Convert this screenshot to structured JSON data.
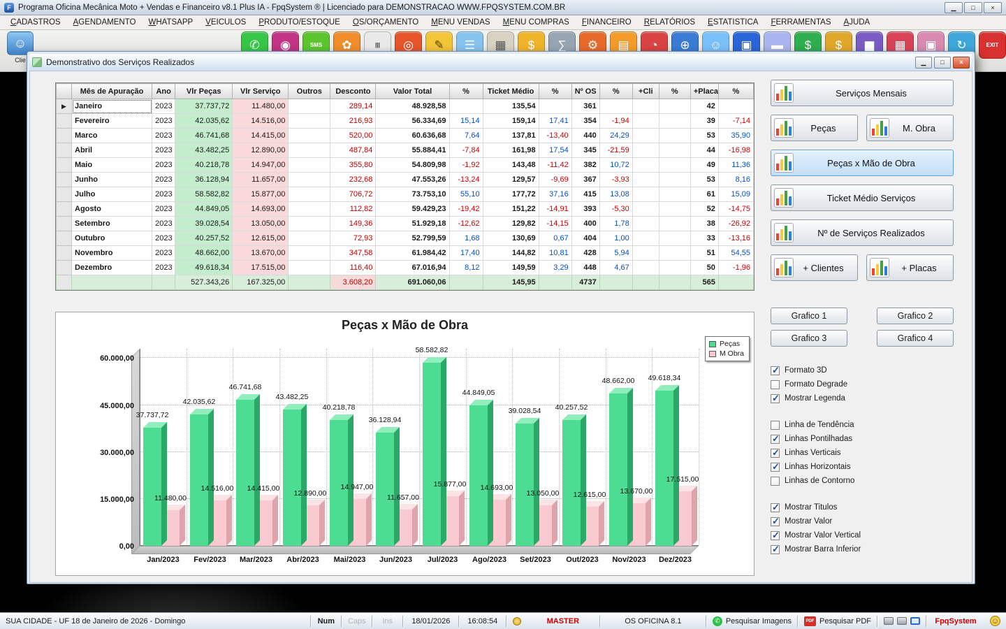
{
  "app": {
    "title": "Programa Oficina Mecânica Moto + Vendas e Financeiro v8.1 Plus IA - FpqSystem ® | Licenciado para  DEMONSTRACAO WWW.FPQSYSTEM.COM.BR",
    "buttons": {
      "minimize": "▁",
      "maximize": "□",
      "close": "×"
    }
  },
  "menubar": {
    "items": [
      "CADASTROS",
      "AGENDAMENTO",
      "WHATSAPP",
      "VEICULOS",
      "PRODUTO/ESTOQUE",
      "OS/ORÇAMENTO",
      "MENU VENDAS",
      "MENU COMPRAS",
      "FINANCEIRO",
      "RELATÓRIOS",
      "ESTATISTICA",
      "FERRAMENTAS",
      "AJUDA"
    ]
  },
  "toolbar": {
    "left_button": {
      "label": "Clie",
      "glyph": "☺"
    },
    "icons": [
      {
        "name": "whatsapp-icon",
        "glyph": "✆",
        "bg": "#36c746"
      },
      {
        "name": "instagram-icon",
        "glyph": "◉",
        "bg": "#c13584"
      },
      {
        "name": "sms-icon",
        "glyph": "SMS",
        "bg": "#5cc52e"
      },
      {
        "name": "produtos-icon",
        "glyph": "✿",
        "bg": "#f08c2a"
      },
      {
        "name": "barcode-icon",
        "glyph": "|||",
        "bg": "#e9e9e9",
        "fg": "#222222"
      },
      {
        "name": "ordem-servico-icon",
        "glyph": "◎",
        "bg": "#e8542a"
      },
      {
        "name": "orcamento-icon",
        "glyph": "✎",
        "bg": "#f3c63a",
        "fg": "#554400"
      },
      {
        "name": "checklist-icon",
        "glyph": "☰",
        "bg": "#86c3ef"
      },
      {
        "name": "agenda-icon",
        "glyph": "▦",
        "bg": "#d8d2c2",
        "fg": "#555555"
      },
      {
        "name": "caixa-icon",
        "glyph": "$",
        "bg": "#f0b42a"
      },
      {
        "name": "calculadora-icon",
        "glyph": "∑",
        "bg": "#97a5b2"
      },
      {
        "name": "ferramentas-icon",
        "glyph": "⚙",
        "bg": "#e86a2a"
      },
      {
        "name": "pastas-icon",
        "glyph": "▤",
        "bg": "#f49b2a"
      },
      {
        "name": "horario-icon",
        "glyph": "◔",
        "bg": "#d94343"
      },
      {
        "name": "internet-icon",
        "glyph": "⊕",
        "bg": "#3a7bd5"
      },
      {
        "name": "clientes-icon",
        "glyph": "☺",
        "bg": "#79c0f8"
      },
      {
        "name": "computador-icon",
        "glyph": "▣",
        "bg": "#2a66d9"
      },
      {
        "name": "cartoes-icon",
        "glyph": "▬",
        "bg": "#aab4ee"
      },
      {
        "name": "financeiro-icon",
        "glyph": "$",
        "bg": "#2fae4f"
      },
      {
        "name": "lucro-icon",
        "glyph": "$",
        "bg": "#e0a82a"
      },
      {
        "name": "graficos-icon",
        "glyph": "▆",
        "bg": "#7a5cc4"
      },
      {
        "name": "calendario-icon",
        "glyph": "▦",
        "bg": "#d94358"
      },
      {
        "name": "impressora-icon",
        "glyph": "▣",
        "bg": "#d98ab0"
      },
      {
        "name": "atualizar-icon",
        "glyph": "↻",
        "bg": "#3fa7d9"
      },
      {
        "name": "sair-icon",
        "glyph": "EXIT",
        "bg": "#d93030"
      }
    ]
  },
  "dialog": {
    "title": "Demonstrativo dos Serviços Realizados",
    "buttons": {
      "minimize": "▁",
      "maximize": "□",
      "close": "×"
    },
    "table": {
      "headers": [
        "Mês de Apuração",
        "Ano",
        "Vlr Peças",
        "Vlr Serviço",
        "Outros",
        "Desconto",
        "Valor Total",
        "%",
        "Ticket Médio",
        "%",
        "Nº OS",
        "%",
        "+Cli",
        "%",
        "+Placa",
        "%"
      ],
      "rows": [
        {
          "mes": "Janeiro",
          "ano": "2023",
          "pecas": "37.737,72",
          "servico": "11.480,00",
          "desconto": "289,14",
          "total": "48.928,58",
          "pct_total": "",
          "ticket": "135,54",
          "pct_ticket": "",
          "os": "361",
          "pct_os": "",
          "placa": "42",
          "pct_placa": ""
        },
        {
          "mes": "Fevereiro",
          "ano": "2023",
          "pecas": "42.035,62",
          "servico": "14.516,00",
          "desconto": "216,93",
          "total": "56.334,69",
          "pct_total": "15,14",
          "ticket": "159,14",
          "pct_ticket": "17,41",
          "os": "354",
          "pct_os": "-1,94",
          "placa": "39",
          "pct_placa": "-7,14"
        },
        {
          "mes": "Marco",
          "ano": "2023",
          "pecas": "46.741,68",
          "servico": "14.415,00",
          "desconto": "520,00",
          "total": "60.636,68",
          "pct_total": "7,64",
          "ticket": "137,81",
          "pct_ticket": "-13,40",
          "os": "440",
          "pct_os": "24,29",
          "placa": "53",
          "pct_placa": "35,90"
        },
        {
          "mes": "Abril",
          "ano": "2023",
          "pecas": "43.482,25",
          "servico": "12.890,00",
          "desconto": "487,84",
          "total": "55.884,41",
          "pct_total": "-7,84",
          "ticket": "161,98",
          "pct_ticket": "17,54",
          "os": "345",
          "pct_os": "-21,59",
          "placa": "44",
          "pct_placa": "-16,98"
        },
        {
          "mes": "Maio",
          "ano": "2023",
          "pecas": "40.218,78",
          "servico": "14.947,00",
          "desconto": "355,80",
          "total": "54.809,98",
          "pct_total": "-1,92",
          "ticket": "143,48",
          "pct_ticket": "-11,42",
          "os": "382",
          "pct_os": "10,72",
          "placa": "49",
          "pct_placa": "11,36"
        },
        {
          "mes": "Junho",
          "ano": "2023",
          "pecas": "36.128,94",
          "servico": "11.657,00",
          "desconto": "232,68",
          "total": "47.553,26",
          "pct_total": "-13,24",
          "ticket": "129,57",
          "pct_ticket": "-9,69",
          "os": "367",
          "pct_os": "-3,93",
          "placa": "53",
          "pct_placa": "8,16"
        },
        {
          "mes": "Julho",
          "ano": "2023",
          "pecas": "58.582,82",
          "servico": "15.877,00",
          "desconto": "706,72",
          "total": "73.753,10",
          "pct_total": "55,10",
          "ticket": "177,72",
          "pct_ticket": "37,16",
          "os": "415",
          "pct_os": "13,08",
          "placa": "61",
          "pct_placa": "15,09"
        },
        {
          "mes": "Agosto",
          "ano": "2023",
          "pecas": "44.849,05",
          "servico": "14.693,00",
          "desconto": "112,82",
          "total": "59.429,23",
          "pct_total": "-19,42",
          "ticket": "151,22",
          "pct_ticket": "-14,91",
          "os": "393",
          "pct_os": "-5,30",
          "placa": "52",
          "pct_placa": "-14,75"
        },
        {
          "mes": "Setembro",
          "ano": "2023",
          "pecas": "39.028,54",
          "servico": "13.050,00",
          "desconto": "149,36",
          "total": "51.929,18",
          "pct_total": "-12,62",
          "ticket": "129,82",
          "pct_ticket": "-14,15",
          "os": "400",
          "pct_os": "1,78",
          "placa": "38",
          "pct_placa": "-26,92"
        },
        {
          "mes": "Outubro",
          "ano": "2023",
          "pecas": "40.257,52",
          "servico": "12.615,00",
          "desconto": "72,93",
          "total": "52.799,59",
          "pct_total": "1,68",
          "ticket": "130,69",
          "pct_ticket": "0,67",
          "os": "404",
          "pct_os": "1,00",
          "placa": "33",
          "pct_placa": "-13,16"
        },
        {
          "mes": "Novembro",
          "ano": "2023",
          "pecas": "48.662,00",
          "servico": "13.670,00",
          "desconto": "347,58",
          "total": "61.984,42",
          "pct_total": "17,40",
          "ticket": "144,82",
          "pct_ticket": "10,81",
          "os": "428",
          "pct_os": "5,94",
          "placa": "51",
          "pct_placa": "54,55"
        },
        {
          "mes": "Dezembro",
          "ano": "2023",
          "pecas": "49.618,34",
          "servico": "17.515,00",
          "desconto": "116,40",
          "total": "67.016,94",
          "pct_total": "8,12",
          "ticket": "149,59",
          "pct_ticket": "3,29",
          "os": "448",
          "pct_os": "4,67",
          "placa": "50",
          "pct_placa": "-1,96"
        }
      ],
      "totals": {
        "pecas": "527.343,26",
        "servico": "167.325,00",
        "desconto": "3.608,20",
        "total": "691.060,06",
        "ticket": "145,95",
        "os": "4737",
        "placa": "565"
      }
    },
    "side_panel": {
      "view_buttons": [
        {
          "label": "Serviços Mensais",
          "width": "full"
        },
        {
          "label": "Peças",
          "width": "half"
        },
        {
          "label": "M. Obra",
          "width": "half"
        },
        {
          "label": "Peças x Mão de Obra",
          "width": "full",
          "active": true
        },
        {
          "label": "Ticket Médio Serviços",
          "width": "full"
        },
        {
          "label": "Nº de Serviços Realizados",
          "width": "full"
        },
        {
          "label": "+ Clientes",
          "width": "half"
        },
        {
          "label": "+ Placas",
          "width": "half"
        }
      ],
      "graph_buttons": [
        "Grafico 1",
        "Grafico 2",
        "Grafico 3",
        "Grafico 4"
      ],
      "checkbox_groups": [
        [
          {
            "label": "Formato 3D",
            "checked": true
          },
          {
            "label": "Formato Degrade",
            "checked": false
          },
          {
            "label": "Mostrar Legenda",
            "checked": true
          }
        ],
        [
          {
            "label": "Linha de Tendência",
            "checked": false
          },
          {
            "label": "Linhas Pontilhadas",
            "checked": true
          },
          {
            "label": "Linhas Verticais",
            "checked": true
          },
          {
            "label": "Linhas Horizontais",
            "checked": true
          },
          {
            "label": "Linhas de Contorno",
            "checked": false
          }
        ],
        [
          {
            "label": "Mostrar Titulos",
            "checked": true
          },
          {
            "label": "Mostrar Valor",
            "checked": true
          },
          {
            "label": "Mostrar Valor Vertical",
            "checked": true
          },
          {
            "label": "Mostrar Barra Inferior",
            "checked": true
          }
        ]
      ]
    }
  },
  "chart_data": {
    "type": "bar",
    "style": "3d-bar",
    "title": "Peças x Mão de Obra",
    "categories": [
      "Jan/2023",
      "Fev/2023",
      "Mar/2023",
      "Abr/2023",
      "Mai/2023",
      "Jun/2023",
      "Jul/2023",
      "Ago/2023",
      "Set/2023",
      "Out/2023",
      "Nov/2023",
      "Dez/2023"
    ],
    "series": [
      {
        "name": "Peças",
        "color": "#4cdd92",
        "values": [
          37737.72,
          42035.62,
          46741.68,
          43482.25,
          40218.78,
          36128.94,
          58582.82,
          44849.05,
          39028.54,
          40257.52,
          48662.0,
          49618.34
        ],
        "labels": [
          "37.737,72",
          "42.035,62",
          "46.741,68",
          "43.482,25",
          "40.218,78",
          "36.128,94",
          "58.582,82",
          "44.849,05",
          "39.028,54",
          "40.257,52",
          "48.662,00",
          "49.618,34"
        ]
      },
      {
        "name": "M Obra",
        "color": "#f9cbd0",
        "values": [
          11480,
          14516,
          14415,
          12890,
          14947,
          11657,
          15877,
          14693,
          13050,
          12615,
          13670,
          17515
        ],
        "labels": [
          "11.480,00",
          "14.516,00",
          "14.415,00",
          "12.890,00",
          "14.947,00",
          "11.657,00",
          "15.877,00",
          "14.693,00",
          "13.050,00",
          "12.615,00",
          "13.670,00",
          "17.515,00"
        ]
      }
    ],
    "ylim": [
      0,
      60000
    ],
    "yticks": [
      "0,00",
      "15.000,00",
      "30.000,00",
      "45.000,00",
      "60.000,00"
    ],
    "ytick_values": [
      0,
      15000,
      30000,
      45000,
      60000
    ],
    "grid": true,
    "legend_position": "top-right"
  },
  "statusbar": {
    "location": "SUA CIDADE - UF 18 de Janeiro de 2026 - Domingo",
    "num": "Num",
    "caps": "Caps",
    "ins": "Ins",
    "date": "18/01/2026",
    "time": "16:08:54",
    "user": "MASTER",
    "app_name": "OS OFICINA 8.1",
    "search_images": "Pesquisar Imagens",
    "search_pdf": "Pesquisar PDF",
    "brand": "FpqSystem"
  },
  "colors": {
    "positive_pct": "#0050cc",
    "negative_pct": "#cc0000",
    "col_pecas_bg": "#c3edcc",
    "col_servico_bg": "#f9d9d9",
    "totals_bg": "#d8eeda",
    "active_view_bg": "#cfe6f8"
  }
}
